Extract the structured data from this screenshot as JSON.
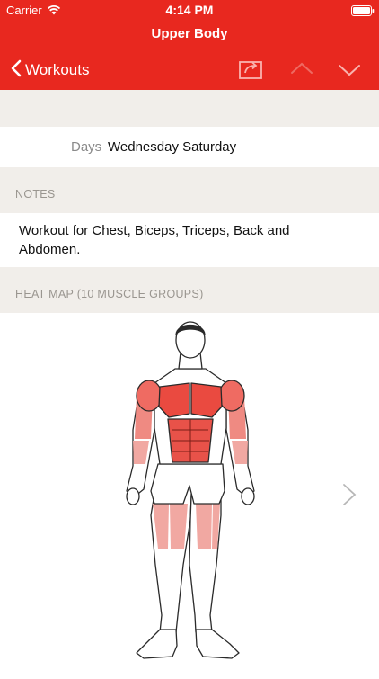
{
  "status_bar": {
    "carrier": "Carrier",
    "time": "4:14 PM"
  },
  "header": {
    "title": "Upper Body",
    "back_label": "Workouts",
    "accent_color": "#e8281f",
    "icons": [
      "share-icon",
      "chevron-up-icon",
      "chevron-down-icon"
    ]
  },
  "schedule": {
    "days_label": "Days",
    "days_value": "Wednesday Saturday"
  },
  "notes": {
    "section_title": "NOTES",
    "text": "Workout for Chest, Biceps, Triceps, Back and Abdomen."
  },
  "heat_map": {
    "section_title": "HEAT MAP (10 MUSCLE GROUPS)",
    "highlight_color": "#e8544c"
  }
}
